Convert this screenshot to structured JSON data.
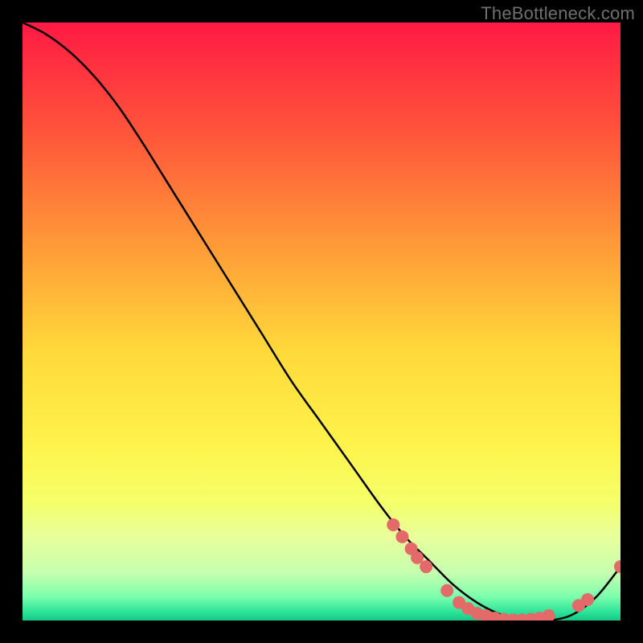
{
  "watermark": "TheBottleneck.com",
  "chart_data": {
    "type": "line",
    "title": "",
    "xlabel": "",
    "ylabel": "",
    "xlim": [
      0,
      100
    ],
    "ylim": [
      0,
      100
    ],
    "gradient_stops": [
      {
        "offset": 0.0,
        "color": "#ff1a44"
      },
      {
        "offset": 0.2,
        "color": "#ff5a3a"
      },
      {
        "offset": 0.4,
        "color": "#ffa438"
      },
      {
        "offset": 0.55,
        "color": "#ffd93a"
      },
      {
        "offset": 0.7,
        "color": "#fff24a"
      },
      {
        "offset": 0.8,
        "color": "#f5ff68"
      },
      {
        "offset": 0.86,
        "color": "#e8ff9a"
      },
      {
        "offset": 0.92,
        "color": "#c6ffb0"
      },
      {
        "offset": 0.96,
        "color": "#7cffad"
      },
      {
        "offset": 0.985,
        "color": "#2fe59a"
      },
      {
        "offset": 1.0,
        "color": "#13c884"
      }
    ],
    "series": [
      {
        "name": "bottleneck-curve",
        "x": [
          0,
          4,
          8,
          12,
          16,
          20,
          25,
          30,
          35,
          40,
          45,
          50,
          55,
          60,
          64,
          68,
          72,
          76,
          80,
          84,
          88,
          92,
          96,
          100
        ],
        "y": [
          100,
          98,
          95,
          91,
          86,
          80,
          72,
          64,
          56,
          48,
          40,
          33,
          26,
          19,
          14,
          10,
          6,
          3,
          1,
          0,
          0,
          1,
          4,
          9
        ]
      }
    ],
    "markers": [
      {
        "x": 62,
        "y": 16
      },
      {
        "x": 63.5,
        "y": 14
      },
      {
        "x": 65,
        "y": 12
      },
      {
        "x": 66,
        "y": 10.5
      },
      {
        "x": 67.5,
        "y": 9
      },
      {
        "x": 71,
        "y": 5
      },
      {
        "x": 73,
        "y": 3
      },
      {
        "x": 74.5,
        "y": 2
      },
      {
        "x": 76,
        "y": 1.2
      },
      {
        "x": 77.5,
        "y": 0.8
      },
      {
        "x": 79,
        "y": 0.4
      },
      {
        "x": 80.5,
        "y": 0.2
      },
      {
        "x": 82,
        "y": 0.1
      },
      {
        "x": 83.5,
        "y": 0.1
      },
      {
        "x": 85,
        "y": 0.2
      },
      {
        "x": 86.5,
        "y": 0.4
      },
      {
        "x": 88,
        "y": 0.8
      },
      {
        "x": 93,
        "y": 2.5
      },
      {
        "x": 94.5,
        "y": 3.5
      },
      {
        "x": 100,
        "y": 9
      }
    ],
    "marker_color": "#e46a6a",
    "marker_radius": 8
  }
}
